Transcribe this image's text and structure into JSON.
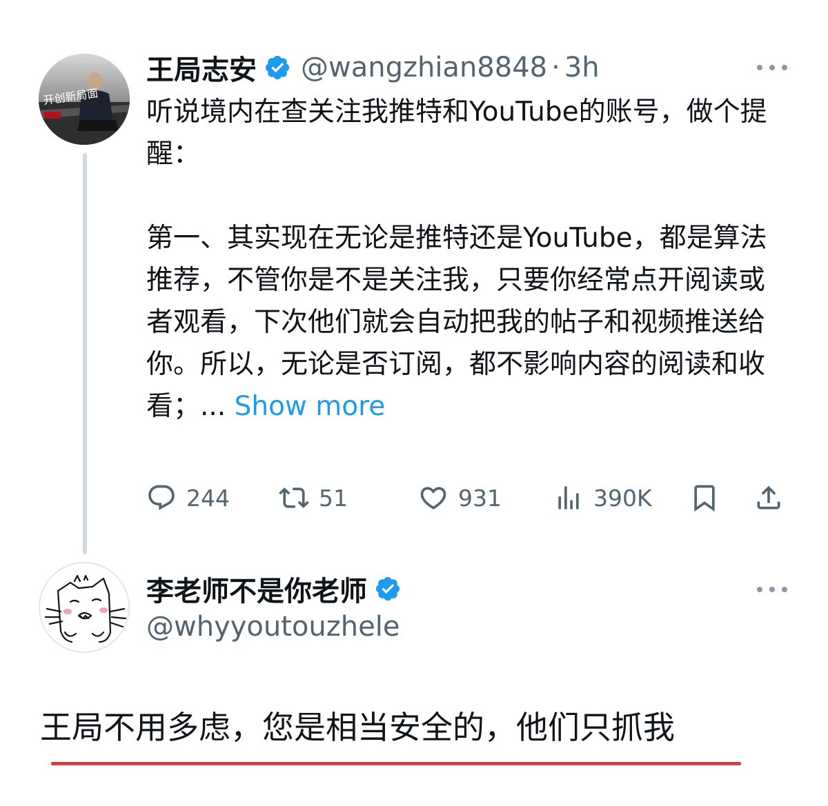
{
  "tweet": {
    "display_name": "王局志安",
    "handle": "@wangzhian8848",
    "separator": "·",
    "time": "3h",
    "avatar_text": "开创新局面",
    "body_paragraph_1": "听说境内在查关注我推特和YouTube的账号，做个提醒：",
    "body_paragraph_2": "第一、其实现在无论是推特还是YouTube，都是算法推荐，不管你是不是关注我，只要你经常点开阅读或者观看，下次他们就会自动把我的帖子和视频推送给你。所以，无论是否订阅，都不影响内容的阅读和收看；... ",
    "show_more": "Show more",
    "stats": {
      "replies": "244",
      "retweets": "51",
      "likes": "931",
      "views": "390K"
    }
  },
  "reply": {
    "display_name": "李老师不是你老师",
    "handle": "@whyyoutouzhele",
    "text": "王局不用多虑，您是相当安全的，他们只抓我"
  },
  "colors": {
    "accent": "#1d9bf0",
    "secondary_text": "#536471",
    "thread_line": "#cfd9de",
    "underline": "#e8343a"
  },
  "icons": [
    "verified-badge-icon",
    "more-icon",
    "reply-icon",
    "retweet-icon",
    "like-icon",
    "views-icon",
    "bookmark-icon",
    "share-icon"
  ]
}
